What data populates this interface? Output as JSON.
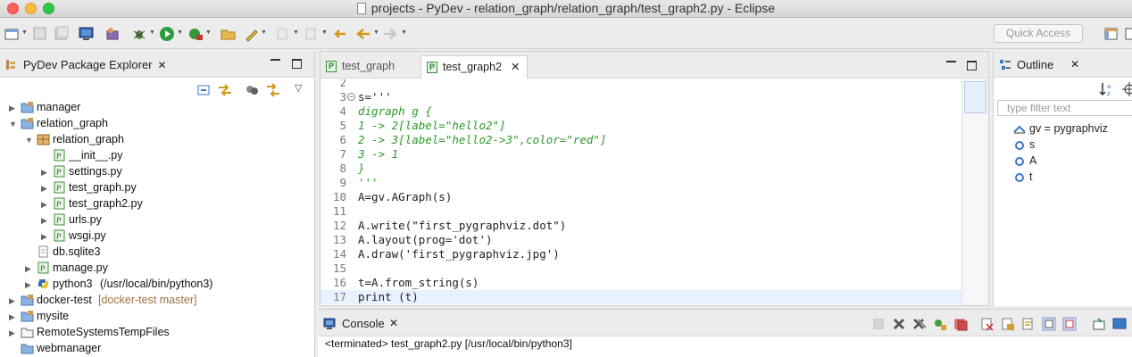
{
  "window": {
    "title": "projects - PyDev - relation_graph/relation_graph/test_graph2.py - Eclipse"
  },
  "toolbar": {
    "quick_access_placeholder": "Quick Access"
  },
  "package_explorer": {
    "title": "PyDev Package Explorer",
    "tree": [
      {
        "label": "manager",
        "icon": "project-folder-icon",
        "expanded": false
      },
      {
        "label": "relation_graph",
        "icon": "project-folder-icon",
        "expanded": true
      },
      {
        "label": "relation_graph",
        "icon": "package-icon",
        "expanded": true
      },
      {
        "label": "__init__.py",
        "icon": "python-file-icon"
      },
      {
        "label": "settings.py",
        "icon": "python-file-icon",
        "expanded": false
      },
      {
        "label": "test_graph.py",
        "icon": "python-file-icon",
        "expanded": false
      },
      {
        "label": "test_graph2.py",
        "icon": "python-file-icon",
        "expanded": false
      },
      {
        "label": "urls.py",
        "icon": "python-file-icon",
        "expanded": false
      },
      {
        "label": "wsgi.py",
        "icon": "python-file-icon",
        "expanded": false
      },
      {
        "label": "db.sqlite3",
        "icon": "file-icon"
      },
      {
        "label": "manage.py",
        "icon": "python-file-icon",
        "expanded": false
      },
      {
        "label": "python3",
        "suffix": "(/usr/local/bin/python3)",
        "icon": "python-interpreter-icon",
        "expanded": false
      },
      {
        "label": "docker-test",
        "decoration": "[docker-test master]",
        "icon": "project-folder-icon",
        "expanded": false
      },
      {
        "label": "mysite",
        "icon": "project-folder-icon",
        "expanded": false
      },
      {
        "label": "RemoteSystemsTempFiles",
        "icon": "folder-icon",
        "expanded": false
      },
      {
        "label": "webmanager",
        "icon": "project-folder-icon"
      }
    ]
  },
  "editor": {
    "tabs": [
      {
        "label": "test_graph",
        "active": false
      },
      {
        "label": "test_graph2",
        "active": true
      }
    ],
    "lines": [
      {
        "num": "2",
        "text": ""
      },
      {
        "num": "3",
        "text": "s='''"
      },
      {
        "num": "4",
        "text": "digraph g {"
      },
      {
        "num": "5",
        "text": "1 -> 2[label=\"hello2\"]"
      },
      {
        "num": "6",
        "text": "2 -> 3[label=\"hello2->3\",color=\"red\"]"
      },
      {
        "num": "7",
        "text": "3 -> 1"
      },
      {
        "num": "8",
        "text": "}"
      },
      {
        "num": "9",
        "text": "'''"
      },
      {
        "num": "10",
        "text": "A=gv.AGraph(s)"
      },
      {
        "num": "11",
        "text": ""
      },
      {
        "num": "12",
        "text": "A.write(\"first_pygraphviz.dot\")"
      },
      {
        "num": "13",
        "text": "A.layout(prog='dot')"
      },
      {
        "num": "14",
        "text": "A.draw('first_pygraphviz.jpg')"
      },
      {
        "num": "15",
        "text": ""
      },
      {
        "num": "16",
        "text": "t=A.from_string(s)"
      },
      {
        "num": "17",
        "text": "print (t)"
      }
    ]
  },
  "outline": {
    "title": "Outline",
    "filter_placeholder": "type filter text",
    "items": [
      {
        "label": "gv = pygraphviz",
        "icon": "import-icon"
      },
      {
        "label": "s",
        "icon": "attribute-icon"
      },
      {
        "label": "A",
        "icon": "attribute-icon"
      },
      {
        "label": "t",
        "icon": "attribute-icon"
      }
    ]
  },
  "console": {
    "title": "Console",
    "status": "<terminated> test_graph2.py [/usr/local/bin/python3]"
  }
}
